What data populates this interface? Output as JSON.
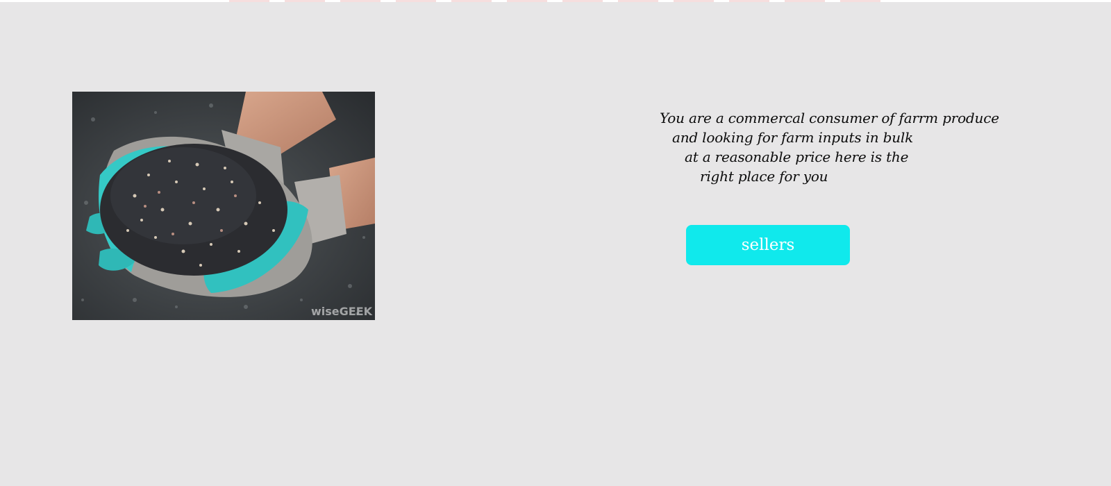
{
  "hero": {
    "image_alt": "Gloved hands holding fertilizer granules",
    "watermark": "wiseGEEK",
    "blurb_lines": [
      "You are a commercal consumer of farrm produce",
      "and looking for farm inputs in bulk",
      "at a reasonable price here is the",
      "right place for you"
    ],
    "sellers_label": "sellers"
  },
  "colors": {
    "page_background": "#e7e6e7",
    "button_background": "#10e9ec",
    "button_text": "#ffffff",
    "glove_palm": "#35c9c6"
  }
}
